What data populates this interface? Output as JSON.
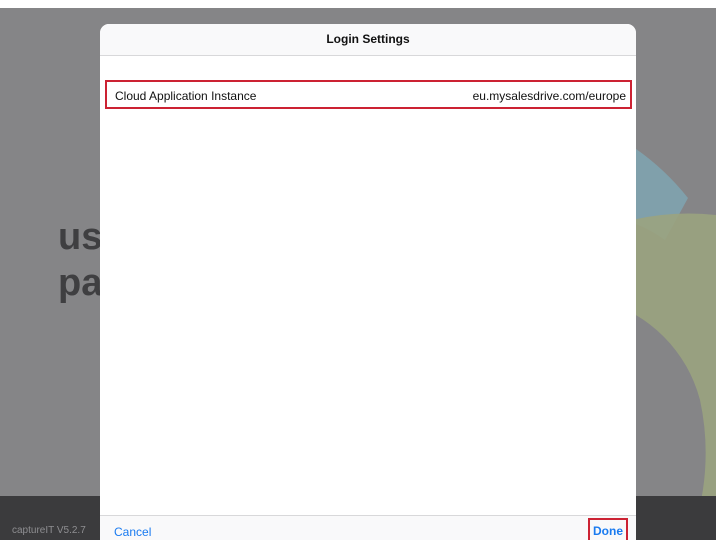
{
  "background": {
    "text_lines": [
      "us",
      "pa"
    ],
    "version": "captureIT V5.2.7"
  },
  "modal": {
    "title": "Login Settings",
    "row": {
      "label": "Cloud Application Instance",
      "value": "eu.mysalesdrive.com/europe"
    },
    "cancel_label": "Cancel",
    "done_label": "Done"
  },
  "colors": {
    "accent": "#1a7bf0",
    "highlight": "#cc2233",
    "chart_blue": "#7fa4b2",
    "chart_green": "#9aa380"
  }
}
